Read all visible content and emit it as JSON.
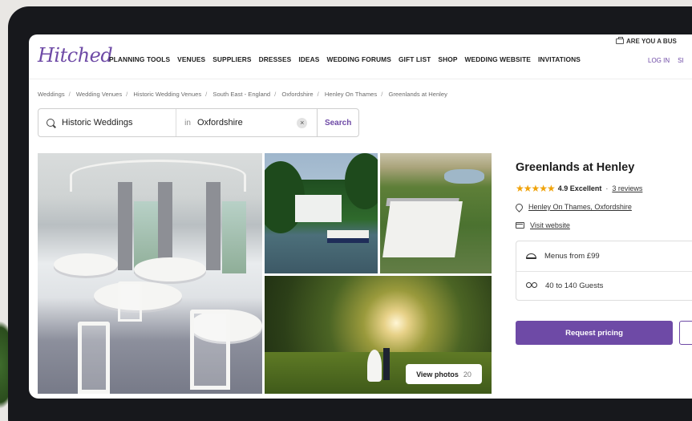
{
  "header": {
    "logo": "Hitched",
    "nav": [
      "PLANNING TOOLS",
      "VENUES",
      "SUPPLIERS",
      "DRESSES",
      "IDEAS",
      "WEDDING FORUMS",
      "GIFT LIST",
      "SHOP",
      "WEDDING WEBSITE",
      "INVITATIONS"
    ],
    "business_link": "ARE YOU A BUS",
    "login": "LOG IN",
    "signup": "SI"
  },
  "breadcrumb": [
    "Weddings",
    "Wedding Venues",
    "Historic Wedding Venues",
    "South East - England",
    "Oxfordshire",
    "Henley On Thames",
    "Greenlands at Henley"
  ],
  "search": {
    "query": "Historic Weddings",
    "in_label": "in",
    "location": "Oxfordshire",
    "clear": "×",
    "button": "Search"
  },
  "gallery": {
    "view_photos_label": "View photos",
    "photo_count": "20"
  },
  "venue": {
    "name": "Greenlands at Henley",
    "stars": "★★★★★",
    "rating": "4.9 Excellent",
    "dot": "·",
    "reviews": "3 reviews",
    "location": "Henley On Thames, Oxfordshire",
    "website": "Visit website",
    "menus": "Menus from £99",
    "guests": "40 to 140 Guests",
    "cta": "Request pricing"
  }
}
